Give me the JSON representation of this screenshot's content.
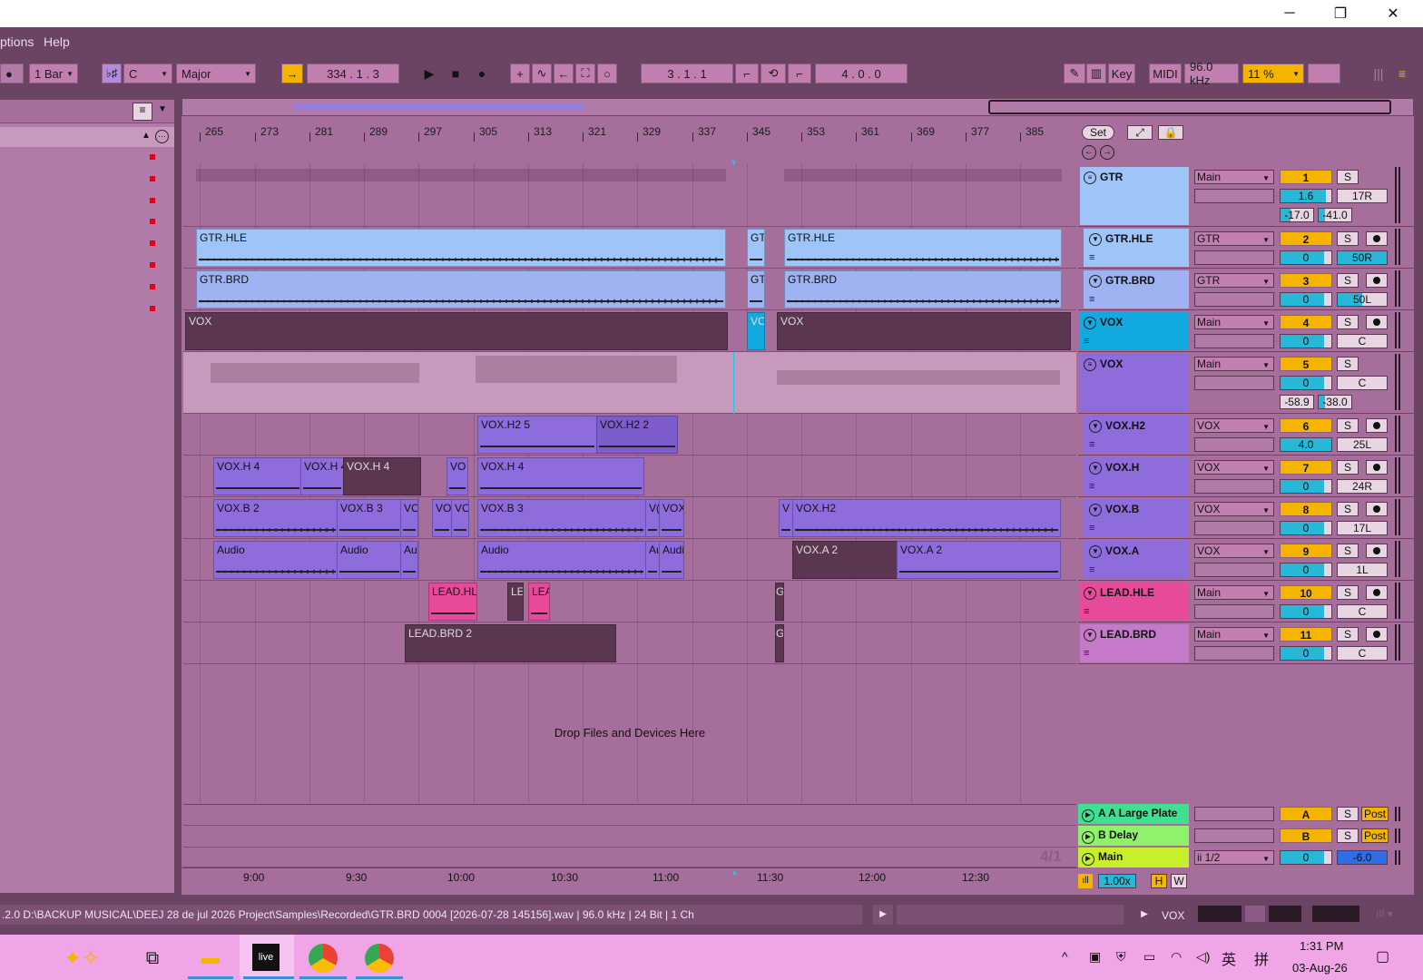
{
  "window": {
    "min": "─",
    "max": "❐",
    "close": "✕"
  },
  "menu": {
    "options": "ptions",
    "help": "Help"
  },
  "control": {
    "quantize": "1 Bar",
    "key_root": "C",
    "scale": "Major",
    "position": "334 .  1 .  3",
    "loop_start": "3 .  1 .  1",
    "loop_len": "4 .  0 .  0",
    "key_btn": "Key",
    "midi_btn": "MIDI",
    "sample_rate": "96.0 kHz",
    "cpu": "11 %"
  },
  "ruler": {
    "bars": [
      "265",
      "273",
      "281",
      "289",
      "297",
      "305",
      "313",
      "321",
      "329",
      "337",
      "345",
      "353",
      "361",
      "369",
      "377",
      "385"
    ],
    "times": [
      "9:00",
      "9:30",
      "10:00",
      "10:30",
      "11:00",
      "11:30",
      "12:00",
      "12:30"
    ]
  },
  "mixer_top": {
    "set": "Set"
  },
  "tracks": [
    {
      "name": "GTR",
      "route": "Main",
      "num": "1",
      "vol": "1.6",
      "pan": "17R",
      "extra1": "-17.0",
      "extra2": "-41.0"
    },
    {
      "name": "GTR.HLE",
      "route": "GTR",
      "num": "2",
      "vol": "0",
      "pan": "50R"
    },
    {
      "name": "GTR.BRD",
      "route": "GTR",
      "num": "3",
      "vol": "0",
      "pan": "50L"
    },
    {
      "name": "VOX",
      "route": "Main",
      "num": "4",
      "vol": "0",
      "pan": "C"
    },
    {
      "name": "VOX",
      "route": "Main",
      "num": "5",
      "vol": "0",
      "pan": "C",
      "extra1": "-58.9",
      "extra2": "-38.0"
    },
    {
      "name": "VOX.H2",
      "route": "VOX",
      "num": "6",
      "vol": "4.0",
      "pan": "25L"
    },
    {
      "name": "VOX.H",
      "route": "VOX",
      "num": "7",
      "vol": "0",
      "pan": "24R"
    },
    {
      "name": "VOX.B",
      "route": "VOX",
      "num": "8",
      "vol": "0",
      "pan": "17L"
    },
    {
      "name": "VOX.A",
      "route": "VOX",
      "num": "9",
      "vol": "0",
      "pan": "1L"
    },
    {
      "name": "LEAD.HLE",
      "route": "Main",
      "num": "10",
      "vol": "0",
      "pan": "C"
    },
    {
      "name": "LEAD.BRD",
      "route": "Main",
      "num": "11",
      "vol": "0",
      "pan": "C"
    }
  ],
  "returns": [
    {
      "name": "A A Large Plate",
      "letter": "A",
      "post": "Post"
    },
    {
      "name": "B Delay",
      "letter": "B",
      "post": "Post"
    },
    {
      "name": "Main",
      "route": "ii 1/2",
      "num": "0",
      "vol": "-6.0"
    }
  ],
  "clips": {
    "gtr_hle": [
      "GTR.HLE",
      "GT",
      "GTR.HLE"
    ],
    "gtr_brd": [
      "GTR.BRD",
      "GT",
      "GTR.BRD"
    ],
    "vox": [
      "VOX",
      "VO",
      "VOX"
    ],
    "voxh2": [
      "VOX.H2 5",
      "VOX.H2 2"
    ],
    "voxh": [
      "VOX.H 4",
      "VOX.H 4",
      "VOX.H 4",
      "VO",
      "VOX.H 4"
    ],
    "voxb": [
      "VOX.B 2",
      "VOX.B 3",
      "VC",
      "VO",
      "VO",
      "VOX.B 3",
      "V(",
      "VOX",
      "V",
      "VOX.H2"
    ],
    "voxa": [
      "Audio",
      "Audio",
      "Au",
      "Audio",
      "Au",
      "Audi",
      "VOX.A 2",
      "VOX.A 2"
    ],
    "lead_hle": [
      "LEAD.HL",
      "LE",
      "LEA",
      "G"
    ],
    "lead_brd": [
      "LEAD.BRD 2",
      "G"
    ]
  },
  "drop_text": "Drop Files and Devices Here",
  "time_sig": "4/1",
  "zoom": "1.00x",
  "h_btn": "H",
  "w_btn": "W",
  "status": {
    "path": ".2.0  D:\\BACKUP MUSICAL\\DEEJ 28 de jul 2026 Project\\Samples\\Recorded\\GTR.BRD 0004 [2026-07-28 145156].wav | 96.0 kHz | 24 Bit | 1 Ch",
    "track": "VOX"
  },
  "taskbar": {
    "live": "live",
    "time": "1:31 PM",
    "date": "03-Aug-26",
    "ime1": "英",
    "ime2": "拼"
  },
  "colors": {
    "accent": "#f4b400",
    "theme": "#6b4463",
    "clip_blue": "#9fc5f8",
    "clip_purple": "#8f6cdc",
    "clip_pink": "#e84a9a"
  }
}
